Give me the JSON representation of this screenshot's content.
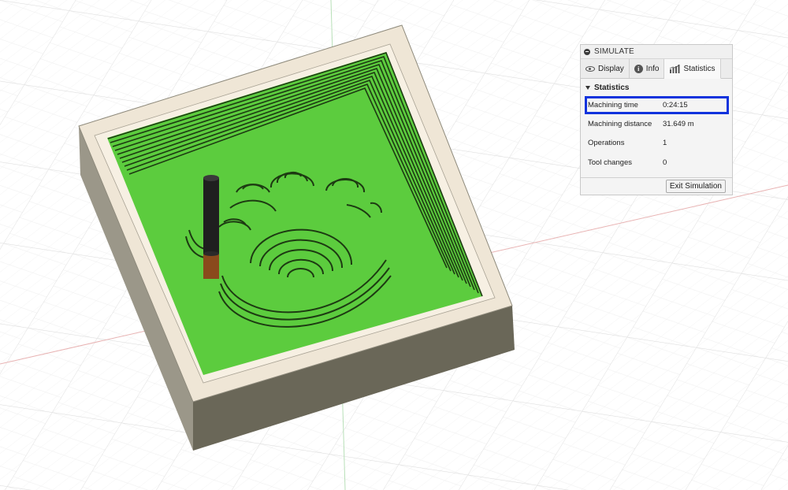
{
  "simulate_panel": {
    "title": "SIMULATE",
    "tabs": [
      {
        "label": "Display",
        "icon": "eye-icon"
      },
      {
        "label": "Info",
        "icon": "info-icon"
      },
      {
        "label": "Statistics",
        "icon": "bar-chart-icon",
        "active": true
      }
    ],
    "section_title": "Statistics",
    "stats": [
      {
        "label": "Machining time",
        "value": "0:24:15",
        "highlighted": true
      },
      {
        "label": "Machining distance",
        "value": "31.649 m"
      },
      {
        "label": "Operations",
        "value": "1"
      },
      {
        "label": "Tool changes",
        "value": "0"
      }
    ],
    "exit_label": "Exit Simulation"
  },
  "viewport": {
    "stock_top_color": "#efe6d6",
    "stock_side_left_color": "#9b9789",
    "stock_side_front_color": "#6a6758",
    "machined_color": "#5ccc3e",
    "wall_line_color": "#1d3a12",
    "highlight_color": "#1133dd",
    "tool_color": "#1f1f1f",
    "holder_color": "#8a4a1c"
  }
}
